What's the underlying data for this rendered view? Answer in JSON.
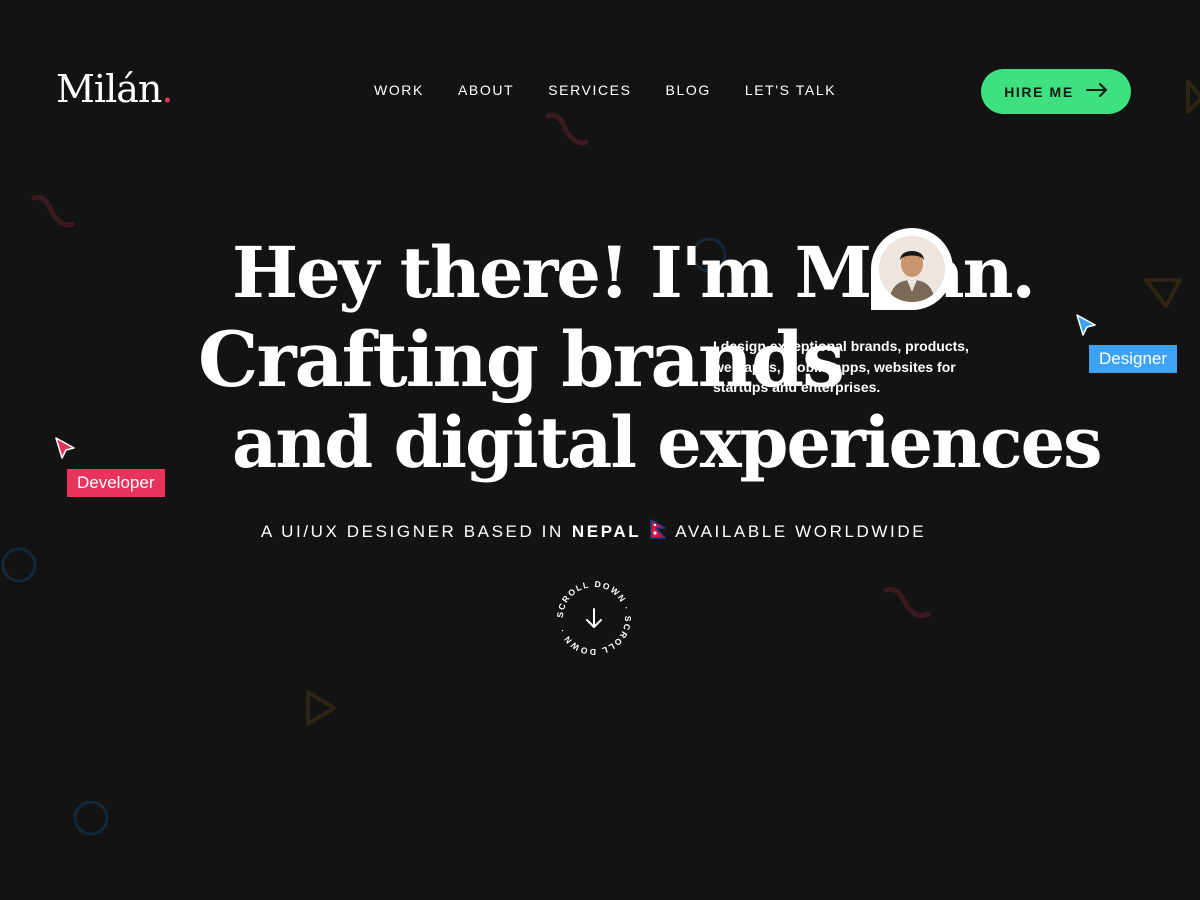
{
  "header": {
    "logo_text": "Milán",
    "logo_dot": ".",
    "nav": [
      "WORK",
      "ABOUT",
      "SERVICES",
      "BLOG",
      "LET'S TALK"
    ],
    "hire_button": "HIRE ME"
  },
  "hero": {
    "line1": "Hey there! I'm Milan.",
    "line2": "Crafting brands",
    "line3": "and digital experiences",
    "subtitle": "I design exceptional brands, products, web apps, mobile apps, websites for startups and enterprises.",
    "tag_developer": "Developer",
    "tag_designer": "Designer",
    "tagline_prefix": "A UI/UX DESIGNER BASED IN",
    "tagline_country": "NEPAL",
    "tagline_suffix": "AVAILABLE WORLDWIDE",
    "scroll_text": "SCROLL DOWN · SCROLL DOWN ·"
  },
  "colors": {
    "background": "#131313",
    "accent_green": "#3ee07f",
    "developer_tag": "#e8345d",
    "designer_tag": "#3fa3f5"
  },
  "icons": [
    "arrow-right-icon",
    "cursor-icon",
    "arrow-down-icon",
    "nepal-flag-icon"
  ]
}
